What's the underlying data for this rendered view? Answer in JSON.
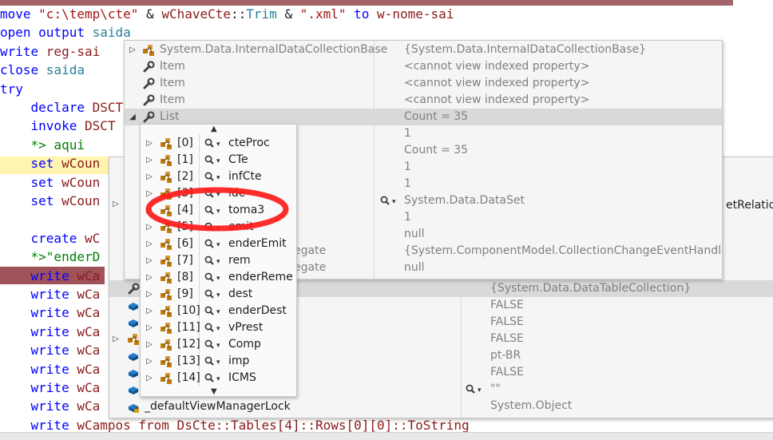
{
  "editor": {
    "lines": [
      {
        "segs": [
          [
            "kw",
            "move "
          ],
          [
            "str",
            "\"c:\\temp\\cte\""
          ],
          [
            "dk",
            " & "
          ],
          [
            "var",
            "wChaveCte"
          ],
          [
            "dk",
            "::"
          ],
          [
            "tl",
            "Trim"
          ],
          [
            "dk",
            " & "
          ],
          [
            "str",
            "\".xml\""
          ],
          [
            "kw",
            " to "
          ],
          [
            "var",
            "w-nome-sai"
          ]
        ]
      },
      {
        "segs": [
          [
            "kw",
            "open output "
          ],
          [
            "tl",
            "saida"
          ]
        ]
      },
      {
        "segs": [
          [
            "kw",
            "write "
          ],
          [
            "var",
            "reg-sai"
          ]
        ]
      },
      {
        "segs": [
          [
            "kw",
            "close "
          ],
          [
            "tl",
            "saida"
          ]
        ]
      },
      {
        "segs": [
          [
            "kw",
            "try"
          ]
        ]
      },
      {
        "segs": [
          [
            "kw",
            "    declare "
          ],
          [
            "var",
            "DSCT"
          ]
        ]
      },
      {
        "segs": [
          [
            "kw",
            "    invoke "
          ],
          [
            "var",
            "DSCT"
          ]
        ]
      },
      {
        "segs": [
          [
            "gn",
            "    *> aqui"
          ]
        ]
      },
      {
        "segs": [
          [
            "kw",
            "    set "
          ],
          [
            "var",
            "wCoun"
          ]
        ]
      },
      {
        "segs": [
          [
            "kw",
            "    set "
          ],
          [
            "var",
            "wCoun"
          ]
        ]
      },
      {
        "segs": [
          [
            "kw",
            "    set "
          ],
          [
            "var",
            "wCoun"
          ]
        ]
      },
      {
        "segs": [
          [
            "dk",
            ""
          ]
        ]
      },
      {
        "segs": [
          [
            "kw",
            "    create "
          ],
          [
            "var",
            "wC"
          ]
        ]
      },
      {
        "segs": [
          [
            "gn",
            "    *>\"enderD"
          ]
        ]
      },
      {
        "segs": [
          [
            "kw",
            "    write "
          ],
          [
            "var",
            "wCa"
          ]
        ]
      },
      {
        "segs": [
          [
            "kw",
            "    write "
          ],
          [
            "var",
            "wCa"
          ]
        ]
      },
      {
        "segs": [
          [
            "kw",
            "    write "
          ],
          [
            "var",
            "wCa"
          ]
        ]
      },
      {
        "segs": [
          [
            "kw",
            "    write "
          ],
          [
            "var",
            "wCa"
          ]
        ]
      },
      {
        "segs": [
          [
            "kw",
            "    write "
          ],
          [
            "var",
            "wCa"
          ]
        ]
      },
      {
        "segs": [
          [
            "kw",
            "    write "
          ],
          [
            "var",
            "wCa"
          ]
        ]
      },
      {
        "segs": [
          [
            "kw",
            "    write "
          ],
          [
            "var",
            "wCa"
          ]
        ]
      },
      {
        "segs": [
          [
            "kw",
            "    write "
          ],
          [
            "var",
            "wCa"
          ]
        ]
      },
      {
        "segs": [
          [
            "kw",
            "    write "
          ],
          [
            "var",
            "wCampos from DsCte::Tables[4]::Rows[0][0]::ToString"
          ]
        ]
      }
    ]
  },
  "tip_main": {
    "rows": [
      {
        "exp": "▷",
        "icon": "class",
        "name": "System.Data.InternalDataCollectionBase",
        "value": "{System.Data.InternalDataCollectionBase}",
        "gray_name": true,
        "gray_value": true
      },
      {
        "exp": "",
        "icon": "wrench",
        "name": "Item",
        "value": "<cannot view indexed property>",
        "gray_name": true,
        "gray_value": true
      },
      {
        "exp": "",
        "icon": "wrench",
        "name": "Item",
        "value": "<cannot view indexed property>",
        "gray_name": true,
        "gray_value": true
      },
      {
        "exp": "",
        "icon": "wrench",
        "name": "Item",
        "value": "<cannot view indexed property>",
        "gray_name": true,
        "gray_value": true
      },
      {
        "exp": "◢",
        "icon": "wrench",
        "name": "List",
        "value": "Count = 35",
        "gray_name": true,
        "gray_value": true,
        "selected": true
      },
      {
        "exp": "",
        "icon": "",
        "name": "",
        "value": "1",
        "gray_value": true
      },
      {
        "exp": "",
        "icon": "",
        "name": "",
        "value": "Count = 35",
        "gray_value": true
      },
      {
        "exp": "",
        "icon": "",
        "name": "",
        "value": "1",
        "gray_value": true
      },
      {
        "exp": "",
        "icon": "",
        "name": "",
        "value": "1",
        "gray_value": true
      },
      {
        "exp": "",
        "icon": "",
        "name": "",
        "value": "System.Data.DataSet",
        "gray_value": true,
        "mag": true
      },
      {
        "exp": "",
        "icon": "",
        "name": "",
        "value": "1",
        "gray_value": true
      },
      {
        "exp": "",
        "icon": "",
        "name": "",
        "value": "null",
        "gray_value": true
      },
      {
        "exp": "",
        "icon": "",
        "name": "egate",
        "value": "{System.ComponentModel.CollectionChangeEventHandler}",
        "gray_name": true,
        "gray_value": true
      },
      {
        "exp": "",
        "icon": "",
        "name": "egate",
        "value": "null",
        "gray_name": true,
        "gray_value": true
      }
    ]
  },
  "tip_back": {
    "right_partial": "etRelation",
    "rows": [
      {
        "value": "{System.Data.DataTableCollection}",
        "selected": true
      },
      {
        "value": "FALSE"
      },
      {
        "value": "FALSE"
      },
      {
        "value": "FALSE"
      },
      {
        "value": "pt-BR"
      },
      {
        "value": "FALSE"
      },
      {
        "value": "\"\"",
        "mag": true
      },
      {
        "value": "System.Object"
      }
    ],
    "last_name": "_defaultViewManagerLock"
  },
  "tip_list": {
    "rows": [
      {
        "index": "[0]",
        "name": "cteProc"
      },
      {
        "index": "[1]",
        "name": "CTe"
      },
      {
        "index": "[2]",
        "name": "infCte"
      },
      {
        "index": "[3]",
        "name": "ide"
      },
      {
        "index": "[4]",
        "name": "toma3"
      },
      {
        "index": "[5]",
        "name": "emit"
      },
      {
        "index": "[6]",
        "name": "enderEmit"
      },
      {
        "index": "[7]",
        "name": "rem"
      },
      {
        "index": "[8]",
        "name": "enderReme"
      },
      {
        "index": "[9]",
        "name": "dest"
      },
      {
        "index": "[10]",
        "name": "enderDest"
      },
      {
        "index": "[11]",
        "name": "vPrest"
      },
      {
        "index": "[12]",
        "name": "Comp"
      },
      {
        "index": "[13]",
        "name": "imp"
      },
      {
        "index": "[14]",
        "name": "ICMS"
      }
    ]
  },
  "colors": {
    "highlight_circle": "#ff1a1a",
    "selection": "#d9d9d9",
    "keyword": "#0000ff",
    "string": "#a31515",
    "variable": "#8b1a1a"
  }
}
